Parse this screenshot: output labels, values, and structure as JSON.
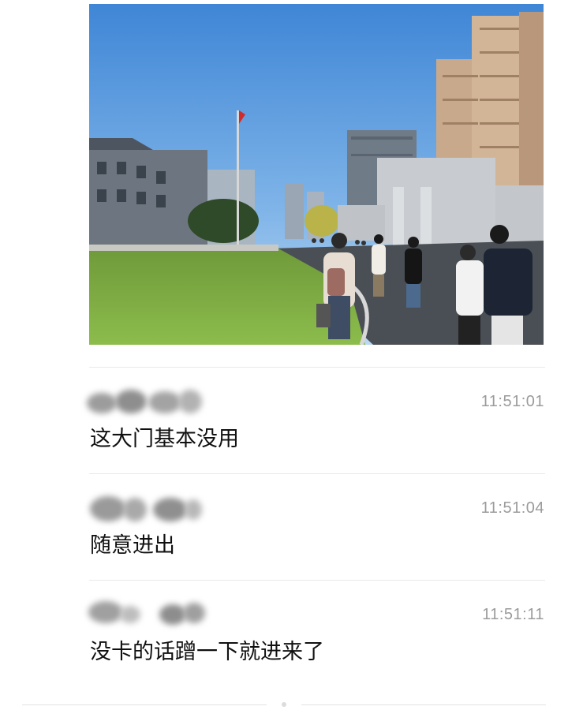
{
  "messages": [
    {
      "time": "11:51:01",
      "text": "这大门基本没用"
    },
    {
      "time": "11:51:04",
      "text": "随意进出"
    },
    {
      "time": "11:51:11",
      "text": "没卡的话蹭一下就进来了"
    }
  ],
  "colors": {
    "time": "#9b9b9b",
    "text": "#111111",
    "divider": "#e9e9e9"
  },
  "icons": [
    "blurred-avatar-name"
  ]
}
